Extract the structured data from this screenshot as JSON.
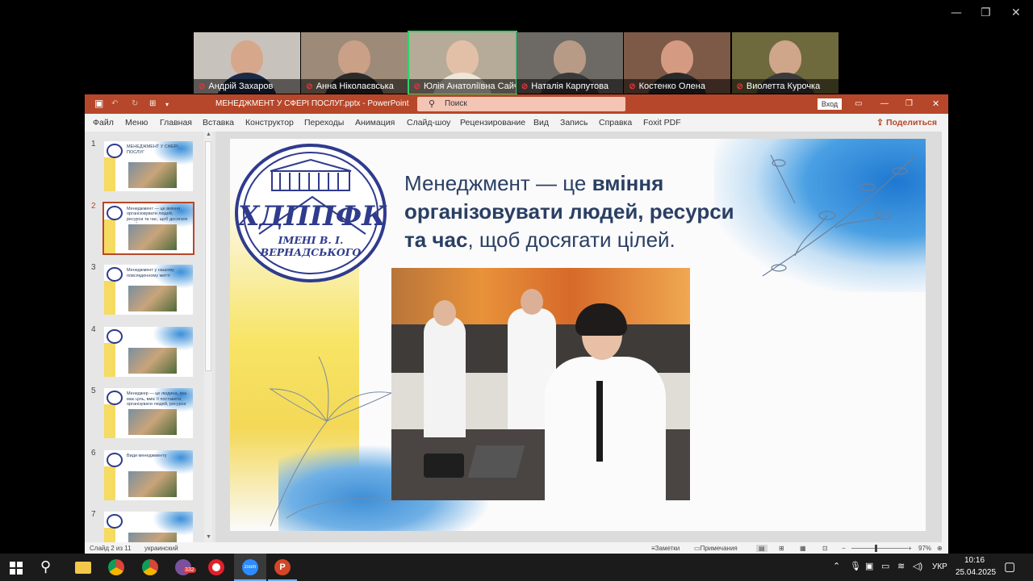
{
  "zoom": {
    "participants": [
      {
        "name": "Андрій Захаров",
        "bg": "#c8c2bd",
        "skin": "#d7a78c",
        "shirt": "#1d2a45"
      },
      {
        "name": "Анна Ніколаєвська",
        "bg": "#9d8a78",
        "skin": "#caa087",
        "shirt": "#2b2b2b"
      },
      {
        "name": "Юлія Анатоліївна Сайчук",
        "bg": "#b6ab98",
        "skin": "#e2c0a8",
        "shirt": "#eee6d8",
        "active": true
      },
      {
        "name": "Наталія Карпутова",
        "bg": "#6d6a66",
        "skin": "#b89b86",
        "shirt": "#3a3a3a"
      },
      {
        "name": "Костенко Олена",
        "bg": "#7c5a47",
        "skin": "#d49b82",
        "shirt": "#2a2a2a"
      },
      {
        "name": "Виолетта Курочка",
        "bg": "#6f6a3d",
        "skin": "#cfa68a",
        "shirt": "#3b3b3b"
      }
    ],
    "window_controls": {
      "minimize": "—",
      "restore": "❐",
      "close": "✕"
    }
  },
  "ppt": {
    "title": "МЕНЕДЖМЕНТ  У  СФЕРІ ПОСЛУГ.pptx  -  PowerPoint",
    "search_placeholder": "Поиск",
    "login": "Вход",
    "menu": [
      "Файл",
      "Меню",
      "Главная",
      "Вставка",
      "Конструктор",
      "Переходы",
      "Анимация",
      "Слайд-шоу",
      "Рецензирование",
      "Вид",
      "Запись",
      "Справка",
      "Foxit PDF"
    ],
    "share": "Поделиться",
    "thumbnails": [
      {
        "num": "1",
        "text": "МЕНЕДЖМЕНТ У СФЕРІ ПОСЛУГ"
      },
      {
        "num": "2",
        "text": "Менеджмент — це вміння організовувати людей, ресурси та час, щоб досягати цілей.",
        "selected": true
      },
      {
        "num": "3",
        "text": "Менеджмент у нашому повсякденному житті"
      },
      {
        "num": "4",
        "text": ""
      },
      {
        "num": "5",
        "text": "Менеджер — це людина, яка має ціль, вміє її поставити, організувати людей, ресурси"
      },
      {
        "num": "6",
        "text": "Види менеджменту"
      },
      {
        "num": "7",
        "text": ""
      }
    ],
    "slide": {
      "logo_abbr": "ХДППФК",
      "logo_name": "ІМЕНІ В. І. ВЕРНАДСЬКОГО",
      "line1_normal": "Менеджмент — це ",
      "line1_bold": "вміння",
      "line2_bold": "організовувати людей, ресурси",
      "line3_bold": "та час",
      "line3_normal": ", щоб досягати цілей."
    },
    "status": {
      "slide_info": "Слайд 2 из 11",
      "language": "украинский",
      "notes": "Заметки",
      "comments": "Примечания",
      "zoom": "97%"
    }
  },
  "taskbar": {
    "language": "УКР",
    "time": "10:16",
    "date": "25.04.2025",
    "viber_badge": "332",
    "zoom_label": "zoom"
  }
}
